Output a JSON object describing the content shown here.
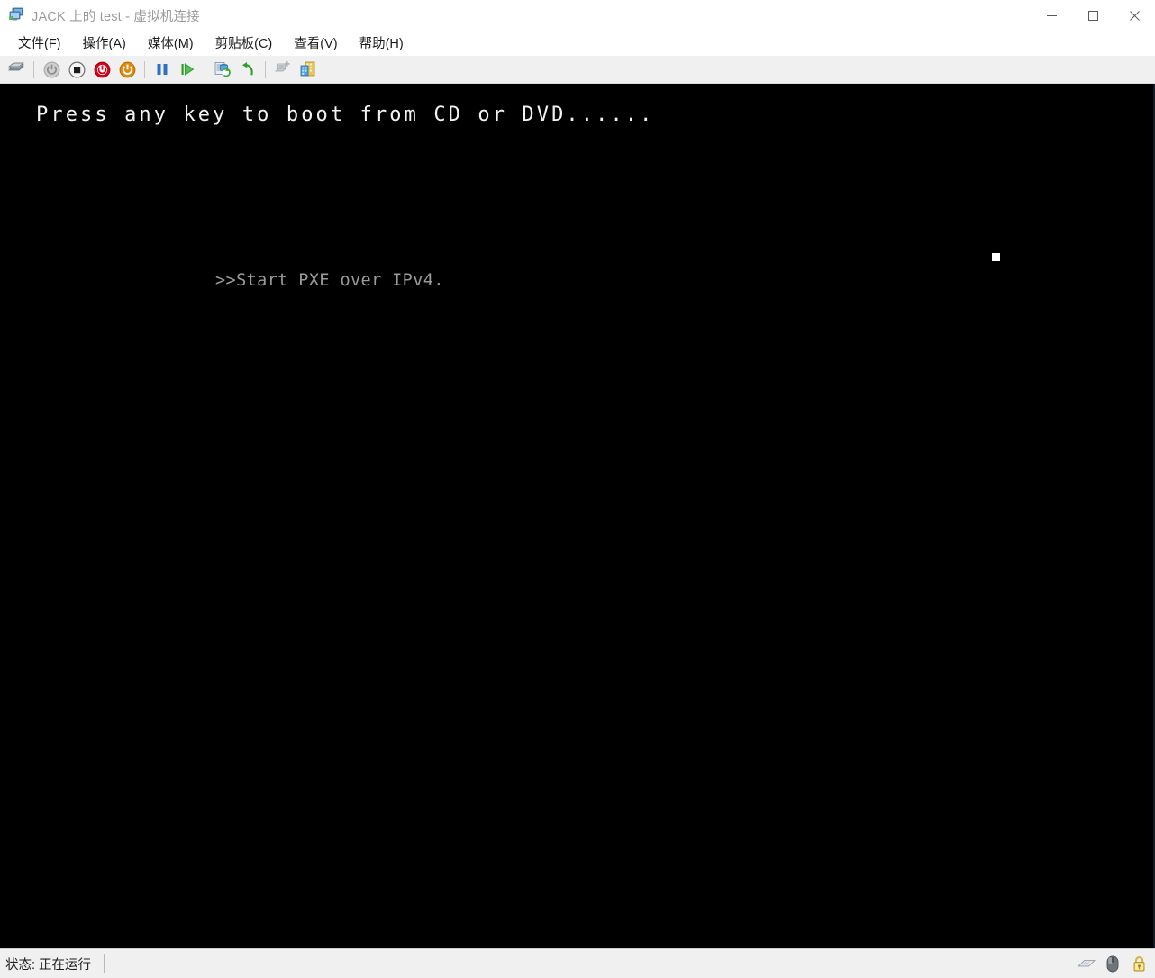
{
  "window": {
    "title": "JACK 上的 test - 虚拟机连接",
    "app_icon": "vm-connect-icon",
    "controls": [
      {
        "name": "minimize-button",
        "icon": "minimize-icon",
        "label": "—"
      },
      {
        "name": "maximize-button",
        "icon": "maximize-icon",
        "label": "□"
      },
      {
        "name": "close-button",
        "icon": "close-icon",
        "label": "✕"
      }
    ]
  },
  "menubar": {
    "items": [
      {
        "label": "文件(F)",
        "name": "menu-file"
      },
      {
        "label": "操作(A)",
        "name": "menu-action"
      },
      {
        "label": "媒体(M)",
        "name": "menu-media"
      },
      {
        "label": "剪贴板(C)",
        "name": "menu-clipboard"
      },
      {
        "label": "查看(V)",
        "name": "menu-view"
      },
      {
        "label": "帮助(H)",
        "name": "menu-help"
      }
    ]
  },
  "toolbar": {
    "buttons": [
      {
        "name": "ctrl-alt-delete-button",
        "icon": "ctrl-alt-del-icon",
        "enabled": true
      },
      {
        "name": "start-button",
        "icon": "power-on-icon",
        "enabled": false
      },
      {
        "name": "turn-off-button",
        "icon": "stop-square-icon",
        "enabled": true
      },
      {
        "name": "shut-down-button",
        "icon": "shutdown-red-icon",
        "enabled": true
      },
      {
        "name": "save-button",
        "icon": "power-orange-icon",
        "enabled": true
      },
      {
        "name": "pause-button",
        "icon": "pause-icon",
        "enabled": true
      },
      {
        "name": "reset-button",
        "icon": "play-green-icon",
        "enabled": true
      },
      {
        "name": "checkpoint-button",
        "icon": "checkpoint-icon",
        "enabled": true
      },
      {
        "name": "revert-button",
        "icon": "revert-arrow-icon",
        "enabled": true
      },
      {
        "name": "move-button",
        "icon": "move-disabled-icon",
        "enabled": false
      },
      {
        "name": "enhanced-session-button",
        "icon": "enhanced-session-icon",
        "enabled": true
      }
    ]
  },
  "console": {
    "boot_prompt": "Press any key to boot from CD or DVD......",
    "pxe_line": ">>Start PXE over IPv4.",
    "cursor": "block-cursor",
    "background_color": "#000000",
    "boot_text_color": "#f2f2f2",
    "pxe_text_color": "#9a9a9a"
  },
  "statusbar": {
    "status": "状态: 正在运行",
    "icons": [
      {
        "name": "keyboard-icon",
        "title": "keyboard"
      },
      {
        "name": "mouse-icon",
        "title": "mouse"
      },
      {
        "name": "lock-icon",
        "title": "lock"
      }
    ]
  }
}
